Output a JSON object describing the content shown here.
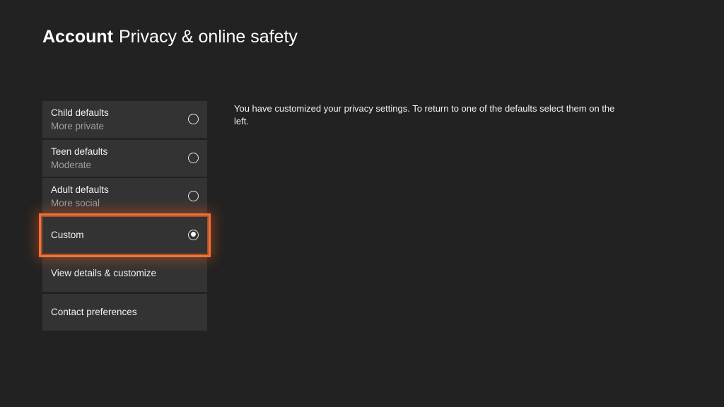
{
  "header": {
    "section": "Account",
    "page": "Privacy & online safety"
  },
  "menu": {
    "items": [
      {
        "title": "Child defaults",
        "subtitle": "More private",
        "radio": "unchecked"
      },
      {
        "title": "Teen defaults",
        "subtitle": "Moderate",
        "radio": "unchecked"
      },
      {
        "title": "Adult defaults",
        "subtitle": "More social",
        "radio": "unchecked"
      },
      {
        "title": "Custom",
        "radio": "checked",
        "focused": true
      },
      {
        "title": "View details & customize"
      },
      {
        "title": "Contact preferences"
      }
    ]
  },
  "description": "You have customized your privacy settings. To return to one of the defaults select them on the left.",
  "colors": {
    "background": "#222222",
    "tile": "#333333",
    "focus": "#f0723a",
    "subtitle": "#9e9e9e"
  }
}
